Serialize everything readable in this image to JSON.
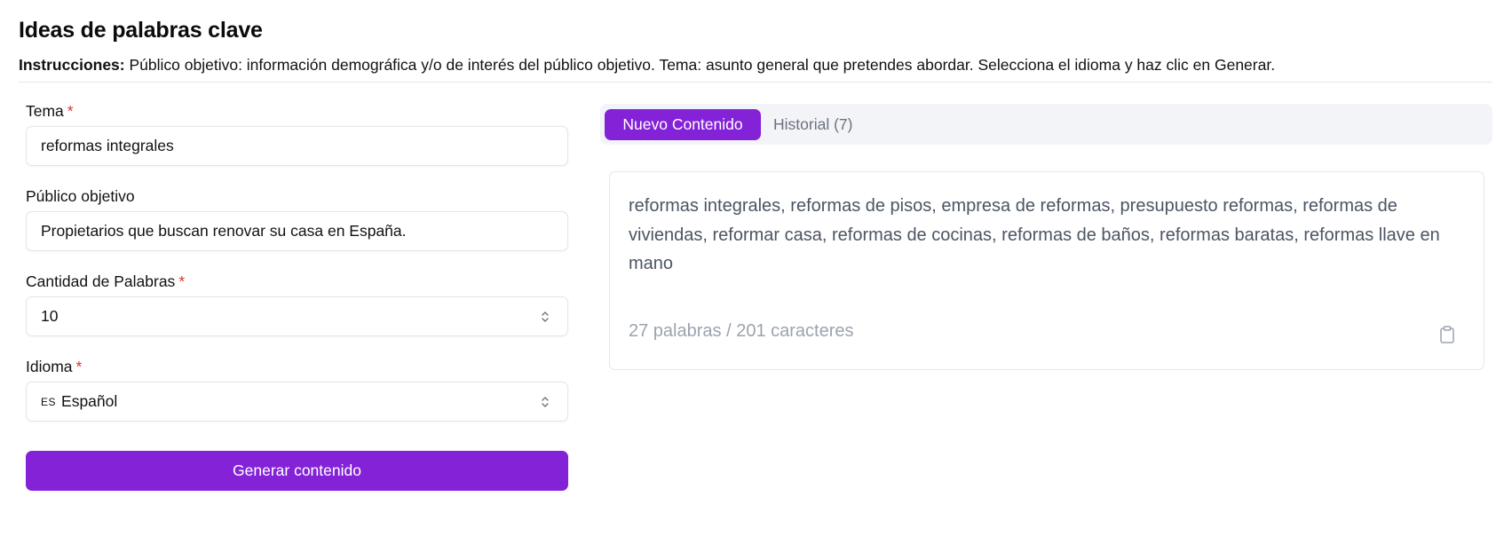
{
  "header": {
    "title": "Ideas de palabras clave",
    "instructions_label": "Instrucciones:",
    "instructions_text": " Público objetivo: información demográfica y/o de interés del público objetivo. Tema: asunto general que pretendes abordar. Selecciona el idioma y haz clic en Generar."
  },
  "form": {
    "tema": {
      "label": "Tema",
      "required_mark": "*",
      "value": "reformas integrales"
    },
    "publico": {
      "label": "Público objetivo",
      "value": "Propietarios que buscan renovar su casa en España."
    },
    "cantidad": {
      "label": "Cantidad de Palabras",
      "required_mark": "*",
      "value": "10"
    },
    "idioma": {
      "label": "Idioma",
      "required_mark": "*",
      "code": "ES",
      "value": "Español"
    },
    "generate_label": "Generar contenido"
  },
  "tabs": {
    "new_label": "Nuevo Contenido",
    "history_label": "Historial (7)"
  },
  "result": {
    "text": "reformas integrales, reformas de pisos, empresa de reformas, presupuesto reformas, reformas de viviendas, reformar casa, reformas de cocinas, reformas de baños, reformas baratas, reformas llave en mano",
    "count": "27 palabras / 201 caracteres"
  },
  "colors": {
    "accent": "#8422d8",
    "required": "#e0352b"
  },
  "icons": {
    "select": "chevron-up-down-icon",
    "copy": "clipboard-icon"
  }
}
